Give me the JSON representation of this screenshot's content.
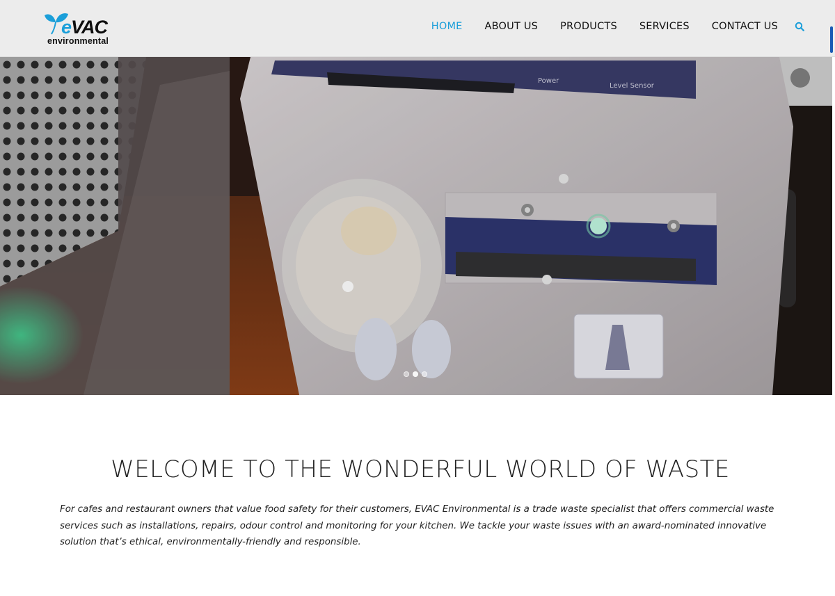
{
  "brand": {
    "name": "VAC",
    "name_prefix": "e",
    "tagline": "environmental",
    "accent_color": "#1a9ed9"
  },
  "nav": {
    "items": [
      {
        "label": "HOME",
        "active": true
      },
      {
        "label": "ABOUT US",
        "active": false
      },
      {
        "label": "PRODUCTS",
        "active": false
      },
      {
        "label": "SERVICES",
        "active": false
      },
      {
        "label": "CONTACT US",
        "active": false
      }
    ],
    "search_icon": "search-icon"
  },
  "hero": {
    "device_labels": [
      "Power",
      "Level Sensor"
    ],
    "slides": 3,
    "active_slide": 2
  },
  "main": {
    "headline": "WELCOME TO THE WONDERFUL WORLD OF WASTE",
    "intro": "For cafes and restaurant owners that value food safety for their customers, EVAC Environmental is a trade waste specialist that offers commercial waste services such as installations, repairs, odour control and monitoring for your kitchen. We tackle your waste issues with an award-nominated innovative solution that’s ethical, environmentally-friendly and responsible."
  }
}
